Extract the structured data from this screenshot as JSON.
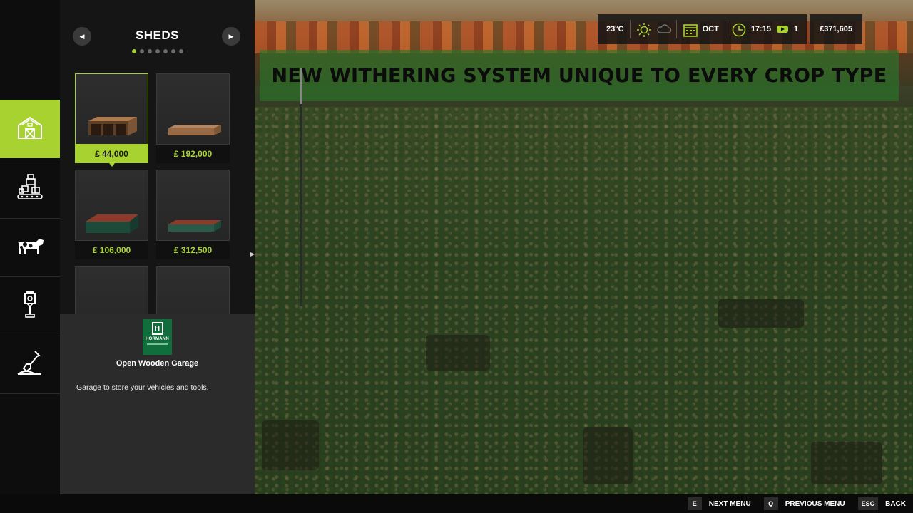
{
  "banner": {
    "text": "NEW WITHERING SYSTEM UNIQUE TO EVERY CROP TYPE"
  },
  "hud": {
    "temperature": "23°C",
    "weather_icons": [
      "sun-icon",
      "cloud-icon"
    ],
    "month": "OCT",
    "time": "17:15",
    "speed": "1",
    "money": "£371,605"
  },
  "rail": {
    "items": [
      {
        "name": "buildings",
        "icon": "barn-icon",
        "active": true
      },
      {
        "name": "production",
        "icon": "factory-icon",
        "active": false
      },
      {
        "name": "animals",
        "icon": "cow-icon",
        "active": false
      },
      {
        "name": "decorations",
        "icon": "lamp-icon",
        "active": false
      },
      {
        "name": "landscaping",
        "icon": "shovel-icon",
        "active": false
      }
    ]
  },
  "shop": {
    "title": "SHEDS",
    "page_count": 7,
    "current_page": 1,
    "items": [
      {
        "price": "£ 44,000",
        "selected": true
      },
      {
        "price": "£ 192,000",
        "selected": false
      },
      {
        "price": "£ 106,000",
        "selected": false
      },
      {
        "price": "£ 312,500",
        "selected": false
      },
      {
        "price": "",
        "selected": false
      },
      {
        "price": "",
        "selected": false
      }
    ]
  },
  "info": {
    "brand": "HÖRMANN",
    "item_name": "Open Wooden Garage",
    "description": "Garage to store your vehicles and tools."
  },
  "bottom_bar": {
    "hints": [
      {
        "key": "E",
        "label": "NEXT MENU"
      },
      {
        "key": "Q",
        "label": "PREVIOUS MENU"
      },
      {
        "key": "ESC",
        "label": "BACK"
      }
    ]
  },
  "colors": {
    "accent": "#a7d230",
    "panel": "#151515",
    "banner": "#287828"
  }
}
